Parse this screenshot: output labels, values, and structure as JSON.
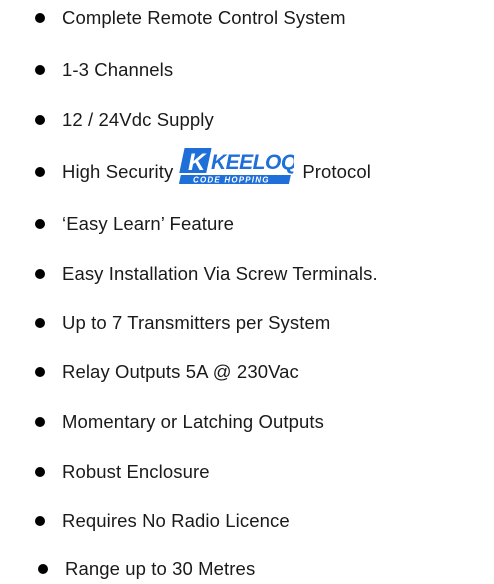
{
  "features": [
    "Complete Remote Control System",
    "1-3 Channels",
    "12 / 24Vdc Supply",
    "‘Easy Learn’ Feature",
    "Easy Installation Via Screw Terminals.",
    "Up to 7 Transmitters per System",
    "Relay Outputs  5A @ 230Vac",
    "Momentary or Latching Outputs",
    "Robust Enclosure",
    "Requires No Radio Licence",
    "Range up to 30 Metres"
  ],
  "security_feature": {
    "prefix": "High Security",
    "suffix": "Protocol",
    "logo": {
      "mark": "K",
      "name": "KEELOQ",
      "tagline": "CODE HOPPING",
      "color": "#1e6fd8"
    }
  },
  "colors": {
    "text": "#1a1a1a",
    "bullet": "#000000",
    "background": "#ffffff"
  }
}
